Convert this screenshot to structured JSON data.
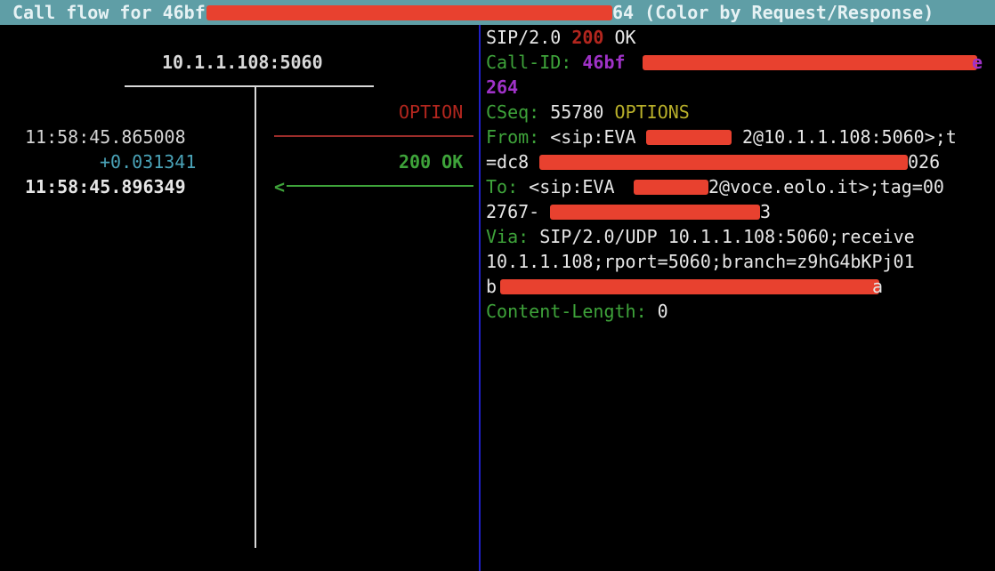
{
  "title": {
    "prefix": "Call flow for 46bf",
    "suffix": "64 (Color by Request/Response)"
  },
  "flow": {
    "host": "10.1.1.108:5060",
    "request": {
      "label": "OPTION",
      "timestamp": "11:58:45.865008"
    },
    "response": {
      "delta": "+0.031341",
      "label": "200 OK",
      "timestamp": "11:58:45.896349",
      "arrow_head": "<"
    }
  },
  "message": {
    "status_line": {
      "protocol": "SIP/2.0",
      "code": "200",
      "reason": "OK"
    },
    "call_id": {
      "name": "Call-ID:",
      "value_start": "46bf",
      "value_end": "e",
      "value_line2": "264"
    },
    "cseq": {
      "name": "CSeq:",
      "number": "55780",
      "method": "OPTIONS"
    },
    "from": {
      "name": "From:",
      "line1_a": "<sip:EVA",
      "line1_b": "2@10.1.1.108:5060>;t",
      "line2_a": "=dc8",
      "line2_b": "026"
    },
    "to": {
      "name": "To:",
      "line1_a": "<sip:EVA",
      "line1_b": "2@voce.eolo.it>;tag=00",
      "line2_a": "2767-",
      "line2_b": "3"
    },
    "via": {
      "name": "Via:",
      "line1": "SIP/2.0/UDP 10.1.1.108:5060;receive",
      "line2": "10.1.1.108;rport=5060;branch=z9hG4bKPj01",
      "line3_a": "b",
      "line3_b": "a"
    },
    "content_length": {
      "name": "Content-Length:",
      "value": "0"
    }
  },
  "colors": {
    "title_bg": "#5f9ea6",
    "divider": "#2020c8",
    "redaction": "#e8412f",
    "request": "#b3261e",
    "response": "#3ea33a",
    "call_id_value": "#a032c8",
    "method": "#b9b02a"
  }
}
